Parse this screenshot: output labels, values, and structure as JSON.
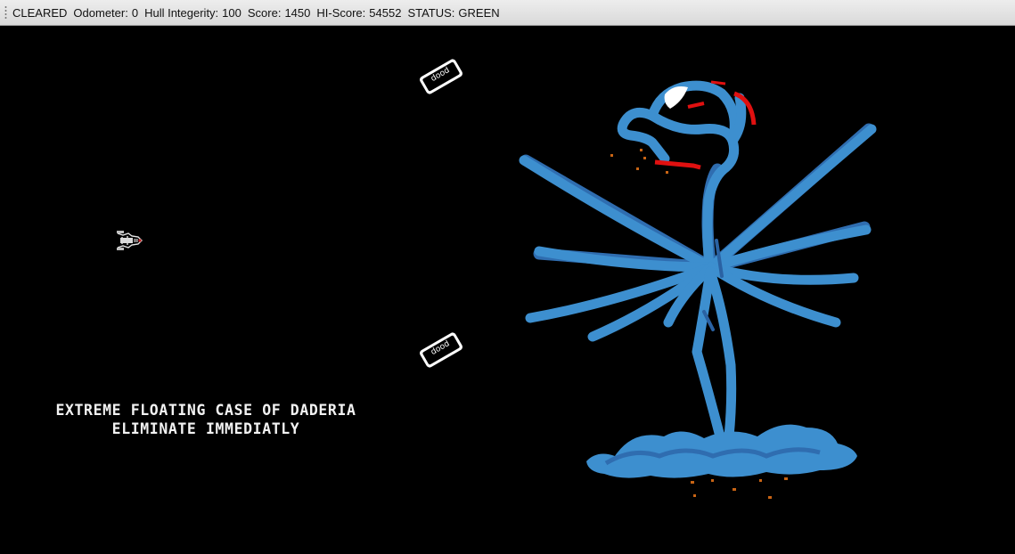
{
  "window": {
    "title": ""
  },
  "status_bar": {
    "state": "CLEARED",
    "odometer_label": "Odometer:",
    "odometer_value": "0",
    "hull_label": "Hull Integerity:",
    "hull_value": "100",
    "score_label": "Score:",
    "score_value": "1450",
    "hiscore_label": "HI-Score:",
    "hiscore_value": "54552",
    "status_label": "STATUS:",
    "status_value": "GREEN"
  },
  "game": {
    "message_line1": "EXTREME FLOATING CASE OF DADERIA",
    "message_line2": "ELIMINATE IMMEDIATLY",
    "card_text": "dood",
    "player": "player-ship-icon",
    "boss": "daderia-creature-icon",
    "colors": {
      "background": "#000000",
      "boss_body": "#3d8fcf",
      "boss_shadow": "#2f6db0",
      "accent_red": "#e01010",
      "text": "#f2f2f2",
      "particles": "#c86414"
    }
  }
}
